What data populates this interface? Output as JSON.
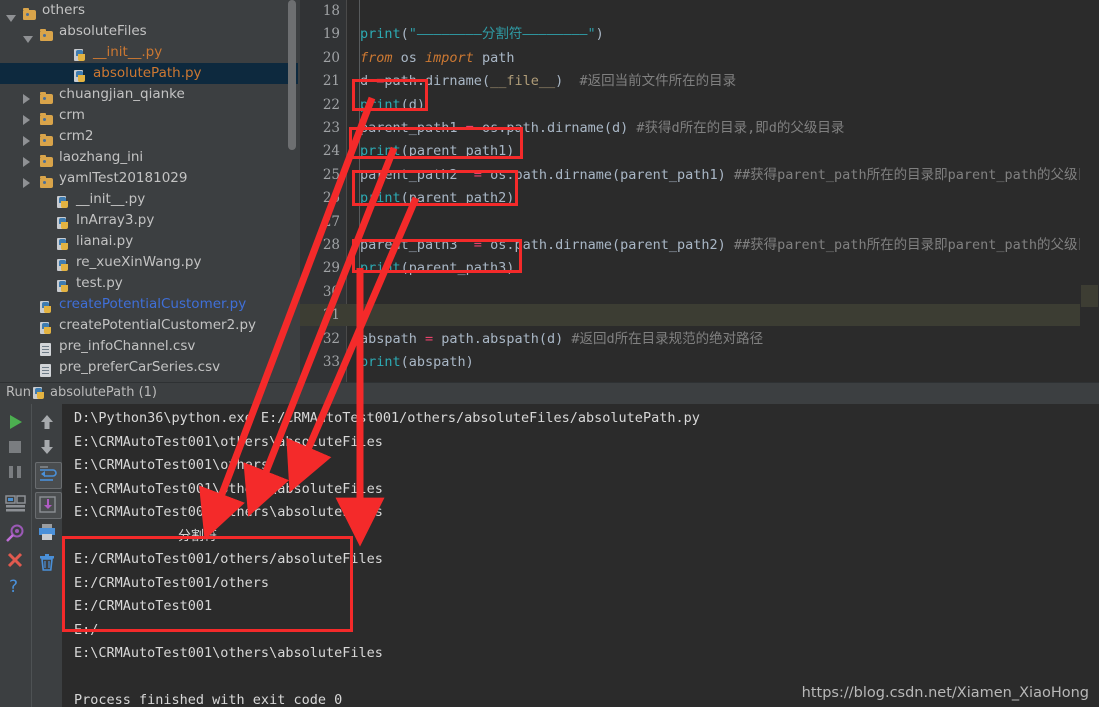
{
  "app": {
    "theme_bg": "#3c3f41",
    "editor_bg": "#2b2b2b",
    "accent_red": "#f42a2a",
    "selection_bg": "#0d293e"
  },
  "project_tree": {
    "items": [
      {
        "label": "others",
        "icon": "folder-icon",
        "indent": 1,
        "toggle": "open",
        "type": "folder",
        "selected": false
      },
      {
        "label": "absoluteFiles",
        "icon": "folder-icon",
        "indent": 2,
        "toggle": "open",
        "type": "folder",
        "selected": false
      },
      {
        "label": "__init__.py",
        "icon": "python-file-icon",
        "indent": 4,
        "toggle": "none",
        "type": "py",
        "selected": false,
        "color": "#cc7832"
      },
      {
        "label": "absolutePath.py",
        "icon": "python-file-icon",
        "indent": 4,
        "toggle": "none",
        "type": "py",
        "selected": true,
        "color": "#cc7832"
      },
      {
        "label": "chuangjian_qianke",
        "icon": "folder-icon",
        "indent": 2,
        "toggle": "closed",
        "type": "folder",
        "selected": false
      },
      {
        "label": "crm",
        "icon": "folder-icon",
        "indent": 2,
        "toggle": "closed",
        "type": "folder",
        "selected": false
      },
      {
        "label": "crm2",
        "icon": "folder-icon",
        "indent": 2,
        "toggle": "closed",
        "type": "folder",
        "selected": false
      },
      {
        "label": "laozhang_ini",
        "icon": "folder-icon",
        "indent": 2,
        "toggle": "closed",
        "type": "folder",
        "selected": false
      },
      {
        "label": "yamlTest20181029",
        "icon": "folder-icon",
        "indent": 2,
        "toggle": "closed",
        "type": "folder",
        "selected": false
      },
      {
        "label": "__init__.py",
        "icon": "python-file-icon",
        "indent": 3,
        "toggle": "none",
        "type": "py",
        "selected": false
      },
      {
        "label": "InArray3.py",
        "icon": "python-file-icon",
        "indent": 3,
        "toggle": "none",
        "type": "py",
        "selected": false
      },
      {
        "label": "lianai.py",
        "icon": "python-file-icon",
        "indent": 3,
        "toggle": "none",
        "type": "py",
        "selected": false
      },
      {
        "label": "re_xueXinWang.py",
        "icon": "python-file-icon",
        "indent": 3,
        "toggle": "none",
        "type": "py",
        "selected": false
      },
      {
        "label": "test.py",
        "icon": "python-file-icon",
        "indent": 3,
        "toggle": "none",
        "type": "py",
        "selected": false
      },
      {
        "label": "createPotentialCustomer.py",
        "icon": "python-file-icon",
        "indent": 2,
        "toggle": "none",
        "type": "py",
        "selected": false,
        "color": "#3f6fd8"
      },
      {
        "label": "createPotentialCustomer2.py",
        "icon": "python-file-icon",
        "indent": 2,
        "toggle": "none",
        "type": "py",
        "selected": false
      },
      {
        "label": "pre_infoChannel.csv",
        "icon": "csv-file-icon",
        "indent": 2,
        "toggle": "none",
        "type": "csv",
        "selected": false
      },
      {
        "label": "pre_preferCarSeries.csv",
        "icon": "csv-file-icon",
        "indent": 2,
        "toggle": "none",
        "type": "csv",
        "selected": false
      }
    ]
  },
  "editor": {
    "first_line_number": 18,
    "highlighted_line": 31,
    "lines": [
      {
        "n": 18,
        "tokens": []
      },
      {
        "n": 19,
        "tokens": [
          {
            "t": "print",
            "c": "fn"
          },
          {
            "t": "(",
            "c": "plain"
          },
          {
            "t": "\"————————分割符————————\"",
            "c": "str"
          },
          {
            "t": ")",
            "c": "plain"
          }
        ]
      },
      {
        "n": 20,
        "tokens": [
          {
            "t": "from",
            "c": "k"
          },
          {
            "t": " os ",
            "c": "plain"
          },
          {
            "t": "import",
            "c": "k"
          },
          {
            "t": " path",
            "c": "plain"
          }
        ]
      },
      {
        "n": 21,
        "tokens": [
          {
            "t": "d ",
            "c": "plain"
          },
          {
            "t": "=",
            "c": "op"
          },
          {
            "t": "path.dirname(",
            "c": "plain"
          },
          {
            "t": "__file__",
            "c": "dunder"
          },
          {
            "t": ")  ",
            "c": "plain"
          },
          {
            "t": "#返回当前文件所在的目录",
            "c": "cmt"
          }
        ]
      },
      {
        "n": 22,
        "tokens": [
          {
            "t": "print",
            "c": "fn"
          },
          {
            "t": "(d)",
            "c": "plain"
          }
        ]
      },
      {
        "n": 23,
        "tokens": [
          {
            "t": "parent_path1 ",
            "c": "plain"
          },
          {
            "t": "=",
            "c": "op"
          },
          {
            "t": " os.path.dirname(d) ",
            "c": "plain"
          },
          {
            "t": "#获得d所在的目录,即d的父级目录",
            "c": "cmt"
          }
        ]
      },
      {
        "n": 24,
        "tokens": [
          {
            "t": "print",
            "c": "fn"
          },
          {
            "t": "(parent_path1)",
            "c": "plain"
          }
        ]
      },
      {
        "n": 25,
        "tokens": [
          {
            "t": "parent_path2  ",
            "c": "plain"
          },
          {
            "t": "=",
            "c": "op"
          },
          {
            "t": " os.path.dirname(parent_path1) ",
            "c": "plain"
          },
          {
            "t": "##获得parent_path所在的目录即parent_path的父级目录",
            "c": "cmt"
          }
        ]
      },
      {
        "n": 26,
        "tokens": [
          {
            "t": "print",
            "c": "fn"
          },
          {
            "t": "(parent_path2)",
            "c": "plain"
          }
        ]
      },
      {
        "n": 27,
        "tokens": []
      },
      {
        "n": 28,
        "tokens": [
          {
            "t": "parent_path3  ",
            "c": "plain"
          },
          {
            "t": "=",
            "c": "op"
          },
          {
            "t": " os.path.dirname(parent_path2) ",
            "c": "plain"
          },
          {
            "t": "##获得parent_path所在的目录即parent_path的父级目录",
            "c": "cmt"
          }
        ]
      },
      {
        "n": 29,
        "tokens": [
          {
            "t": "print",
            "c": "fn"
          },
          {
            "t": "(parent_path3)",
            "c": "plain"
          }
        ]
      },
      {
        "n": 30,
        "tokens": []
      },
      {
        "n": 31,
        "tokens": []
      },
      {
        "n": 32,
        "tokens": [
          {
            "t": "abspath ",
            "c": "plain"
          },
          {
            "t": "=",
            "c": "op"
          },
          {
            "t": " path.abspath(d) ",
            "c": "plain"
          },
          {
            "t": "#返回d所在目录规范的绝对路径",
            "c": "cmt"
          }
        ]
      },
      {
        "n": 33,
        "tokens": [
          {
            "t": "print",
            "c": "fn"
          },
          {
            "t": "(abspath)",
            "c": "plain"
          }
        ]
      }
    ]
  },
  "run_tab": {
    "label": "Run",
    "config_name": "absolutePath (1)",
    "icon": "python-run-icon"
  },
  "run_toolbar": {
    "left_buttons": [
      {
        "name": "rerun-button",
        "icon": "play-icon"
      },
      {
        "name": "stop-button",
        "icon": "stop-icon"
      },
      {
        "name": "pause-button",
        "icon": "pause-icon"
      },
      {
        "name": "restore-layout-button",
        "icon": "layout-icon"
      },
      {
        "name": "filter-button",
        "icon": "filter-icon"
      },
      {
        "name": "close-button",
        "icon": "close-x-icon"
      },
      {
        "name": "help-button",
        "icon": "question-icon"
      }
    ],
    "right_buttons": [
      {
        "name": "scroll-up-button",
        "icon": "arrow-up-icon"
      },
      {
        "name": "scroll-down-button",
        "icon": "arrow-down-icon"
      },
      {
        "name": "soft-wrap-button",
        "icon": "wrap-icon"
      },
      {
        "name": "scroll-to-end-button",
        "icon": "scroll-end-icon"
      },
      {
        "name": "print-button",
        "icon": "printer-icon"
      },
      {
        "name": "clear-all-button",
        "icon": "trash-icon"
      }
    ]
  },
  "console": {
    "lines": [
      {
        "text": "D:\\Python36\\python.exe E:/CRMAutoTest001/others/absoluteFiles/absolutePath.py"
      },
      {
        "text": "E:\\CRMAutoTest001\\others\\absoluteFiles"
      },
      {
        "text": "E:\\CRMAutoTest001\\others"
      },
      {
        "text": "E:\\CRMAutoTest001\\others\\absoluteFiles"
      },
      {
        "text": "E:\\CRMAutoTest001\\others\\absoluteFiles"
      },
      {
        "text": "————————分割符————————",
        "divider": true
      },
      {
        "text": "E:/CRMAutoTest001/others/absoluteFiles"
      },
      {
        "text": "E:/CRMAutoTest001/others"
      },
      {
        "text": "E:/CRMAutoTest001"
      },
      {
        "text": "E:/"
      },
      {
        "text": "E:\\CRMAutoTest001\\others\\absoluteFiles"
      },
      {
        "text": ""
      },
      {
        "text": "Process finished with exit code 0"
      }
    ]
  },
  "annotations": {
    "code_highlight_boxes": [
      {
        "label": "print(d)",
        "line": 22
      },
      {
        "label": "print(parent_path1)",
        "line": 24
      },
      {
        "label": "print(parent_path2)",
        "line": 26
      },
      {
        "label": "print(parent_path3)",
        "line": 29
      }
    ],
    "console_highlight_box": "E:/CRMAutoTest001/others/absoluteFiles ... E:/",
    "arrow_count": 4,
    "color": "#f42a2a"
  },
  "watermark": {
    "text": "https://blog.csdn.net/Xiamen_XiaoHong"
  }
}
